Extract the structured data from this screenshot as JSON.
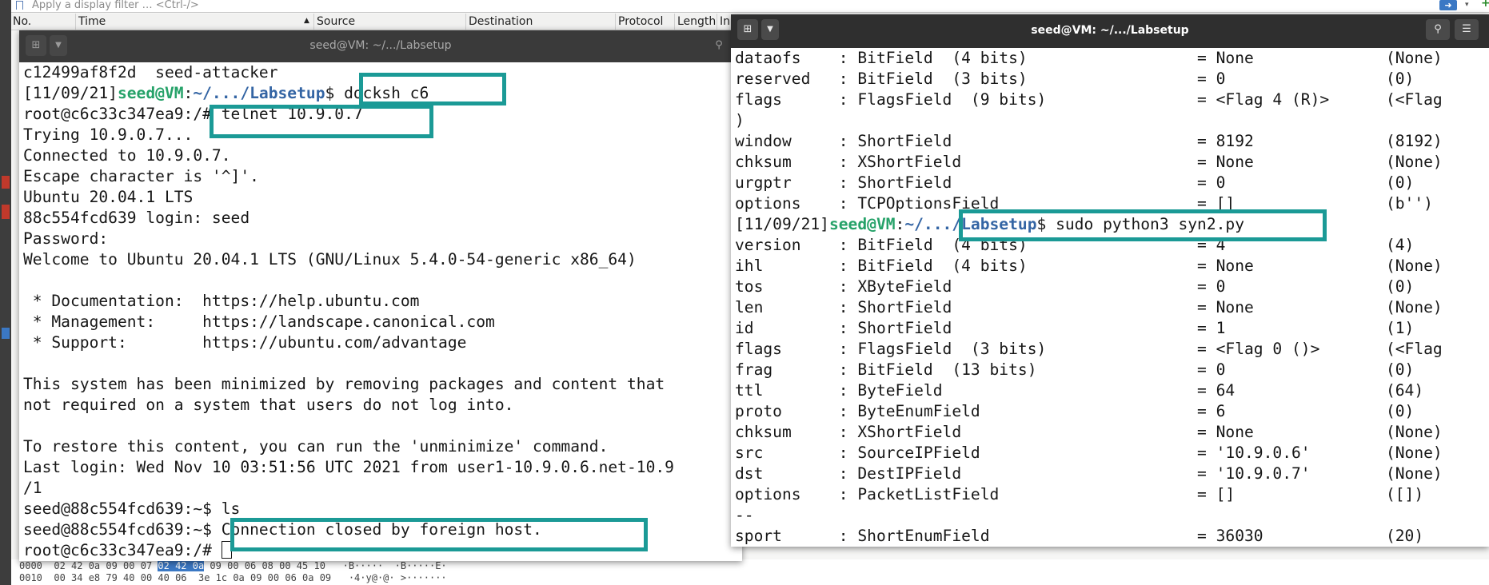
{
  "wireshark": {
    "filter_placeholder": "Apply a display filter … <Ctrl-/>",
    "columns": [
      "No.",
      "Time",
      "Source",
      "Destination",
      "Protocol",
      "Length",
      "In"
    ],
    "hex_rows": [
      {
        "offset": "0000",
        "bytes_a": "02 42 0a 09 00 07 ",
        "bytes_hl": "02 42 0a",
        "bytes_b": " 09 00 06 08 00 45 10",
        "ascii": "·B·····  ·B·····E·"
      },
      {
        "offset": "0010",
        "bytes_a": "00 34 e8 79 40 00 40 06  3e 1c 0a 09 00 06 0a 09",
        "bytes_hl": "",
        "bytes_b": "",
        "ascii": "·4·y@·@· >·······"
      }
    ]
  },
  "left_terminal": {
    "title": "seed@VM: ~/.../Labsetup",
    "lines": [
      {
        "text": "c12499af8f2d  seed-attacker"
      },
      {
        "date": "[11/09/21]",
        "user": "seed@VM",
        "sep": ":",
        "path": "~/.../Labsetup",
        "rest": "$ docksh c6"
      },
      {
        "text": "root@c6c33c347ea9:/# telnet 10.9.0.7"
      },
      {
        "text": "Trying 10.9.0.7..."
      },
      {
        "text": "Connected to 10.9.0.7."
      },
      {
        "text": "Escape character is '^]'."
      },
      {
        "text": "Ubuntu 20.04.1 LTS"
      },
      {
        "text": "88c554fcd639 login: seed"
      },
      {
        "text": "Password:"
      },
      {
        "text": "Welcome to Ubuntu 20.04.1 LTS (GNU/Linux 5.4.0-54-generic x86_64)"
      },
      {
        "text": ""
      },
      {
        "text": " * Documentation:  https://help.ubuntu.com"
      },
      {
        "text": " * Management:     https://landscape.canonical.com"
      },
      {
        "text": " * Support:        https://ubuntu.com/advantage"
      },
      {
        "text": ""
      },
      {
        "text": "This system has been minimized by removing packages and content that"
      },
      {
        "text": "not required on a system that users do not log into."
      },
      {
        "text": ""
      },
      {
        "text": "To restore this content, you can run the 'unminimize' command."
      },
      {
        "text": "Last login: Wed Nov 10 03:51:56 UTC 2021 from user1-10.9.0.6.net-10.9"
      },
      {
        "text": "/1"
      },
      {
        "text": "seed@88c554fcd639:~$ ls"
      },
      {
        "text": "seed@88c554fcd639:~$ Connection closed by foreign host."
      },
      {
        "text": "root@c6c33c347ea9:/# "
      }
    ]
  },
  "right_terminal": {
    "title": "seed@VM: ~/.../Labsetup",
    "lines": [
      {
        "text": "dataofs    : BitField  (4 bits)                  = None              (None)"
      },
      {
        "text": "reserved   : BitField  (3 bits)                  = 0                 (0)"
      },
      {
        "text": "flags      : FlagsField  (9 bits)                = <Flag 4 (R)>      (<Flag"
      },
      {
        "text": ")"
      },
      {
        "text": "window     : ShortField                          = 8192              (8192)"
      },
      {
        "text": "chksum     : XShortField                         = None              (None)"
      },
      {
        "text": "urgptr     : ShortField                          = 0                 (0)"
      },
      {
        "text": "options    : TCPOptionsField                     = []                (b'')"
      },
      {
        "date": "[11/09/21]",
        "user": "seed@VM",
        "sep": ":",
        "path": "~/.../Labsetup",
        "rest": "$ sudo python3 syn2.py"
      },
      {
        "text": "version    : BitField  (4 bits)                  = 4                 (4)"
      },
      {
        "text": "ihl        : BitField  (4 bits)                  = None              (None)"
      },
      {
        "text": "tos        : XByteField                          = 0                 (0)"
      },
      {
        "text": "len        : ShortField                          = None              (None)"
      },
      {
        "text": "id         : ShortField                          = 1                 (1)"
      },
      {
        "text": "flags      : FlagsField  (3 bits)                = <Flag 0 ()>       (<Flag"
      },
      {
        "text": "frag       : BitField  (13 bits)                 = 0                 (0)"
      },
      {
        "text": "ttl        : ByteField                           = 64                (64)"
      },
      {
        "text": "proto      : ByteEnumField                       = 6                 (0)"
      },
      {
        "text": "chksum     : XShortField                         = None              (None)"
      },
      {
        "text": "src        : SourceIPField                       = '10.9.0.6'        (None)"
      },
      {
        "text": "dst        : DestIPField                         = '10.9.0.7'        (None)"
      },
      {
        "text": "options    : PacketListField                     = []                ([])"
      },
      {
        "text": "--"
      },
      {
        "text": "sport      : ShortEnumField                      = 36030             (20)"
      }
    ]
  },
  "icons": {
    "new_tab": "new-tab-icon",
    "dropdown": "chevron-down-icon",
    "search": "search-icon",
    "menu": "hamburger-menu-icon"
  },
  "colors": {
    "annotation": "#1b9a96",
    "prompt_user": "#26a269",
    "prompt_path": "#3465a4"
  }
}
